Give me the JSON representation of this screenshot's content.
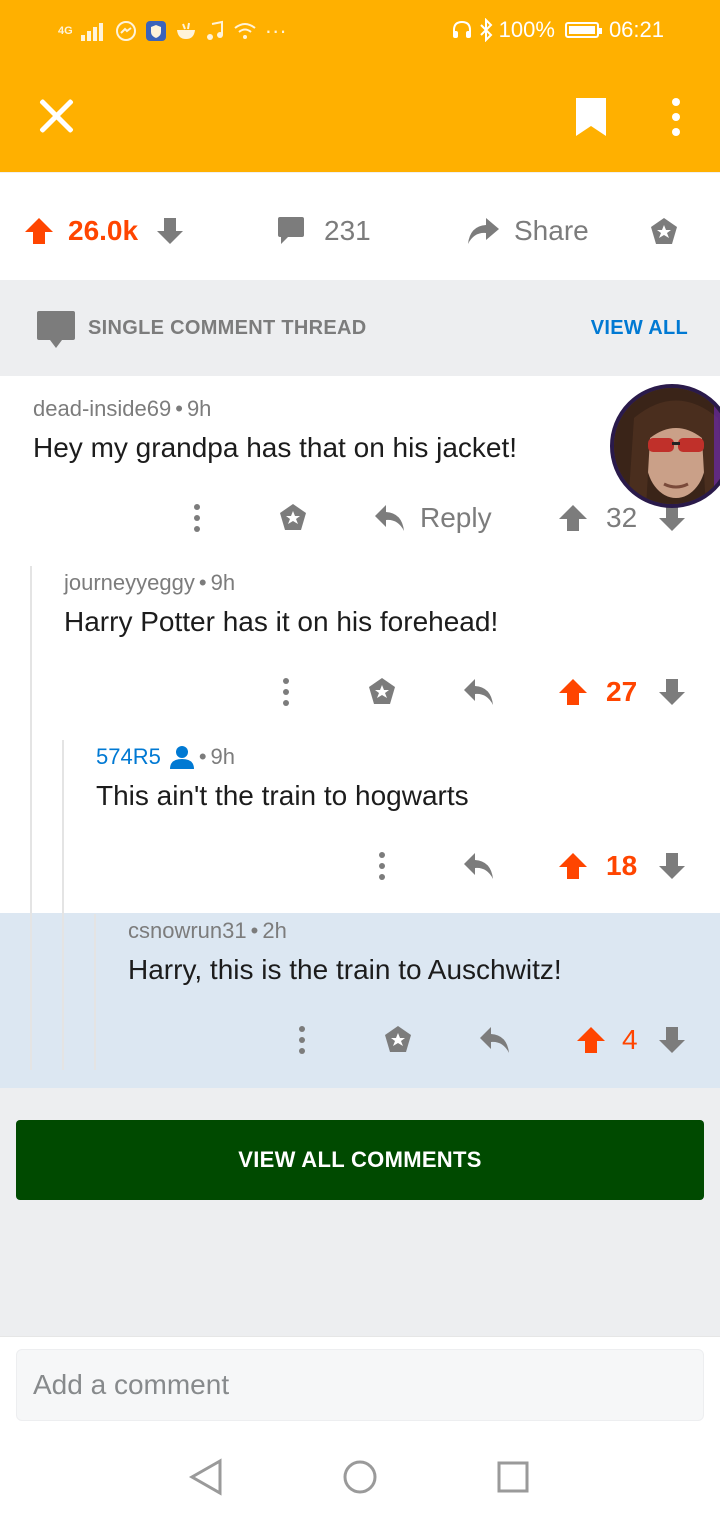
{
  "status_bar": {
    "network": "4G",
    "battery": "100%",
    "time": "06:21"
  },
  "post": {
    "score": "26.0k",
    "comments": "231",
    "share_label": "Share"
  },
  "thread_header": {
    "label": "SINGLE COMMENT THREAD",
    "view_all": "VIEW ALL"
  },
  "comments": [
    {
      "author": "dead-inside69",
      "age": "9h",
      "body": "Hey my grandpa has that on his jacket!",
      "reply_label": "Reply",
      "score": "32"
    },
    {
      "author": "journeyyeggy",
      "age": "9h",
      "body": "Harry Potter has it on his forehead!",
      "score": "27"
    },
    {
      "author": "574R5",
      "age": "9h",
      "body": "This ain't the train to hogwarts",
      "score": "18"
    },
    {
      "author": "csnowrun31",
      "age": "2h",
      "body": "Harry, this is the train to Auschwitz!",
      "score": "4"
    }
  ],
  "footer": {
    "view_all_comments": "VIEW ALL COMMENTS",
    "comment_placeholder": "Add a comment"
  },
  "colors": {
    "app_bar": "#ffb000",
    "upvote": "#ff4500",
    "link_blue": "#0079d3",
    "view_all_button": "#004a00",
    "highlight": "#dce7f2"
  },
  "icons": [
    "close-icon",
    "bookmark-icon",
    "more-vertical-icon",
    "upvote-icon",
    "downvote-icon",
    "comment-icon",
    "share-icon",
    "award-icon",
    "reply-icon",
    "user-icon",
    "back-nav-icon",
    "home-nav-icon",
    "recents-nav-icon"
  ]
}
